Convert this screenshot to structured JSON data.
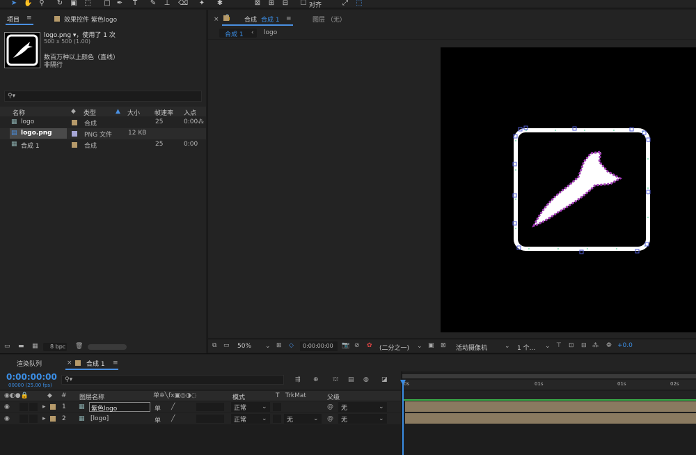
{
  "toolbar": {
    "align_label": "对齐"
  },
  "project": {
    "tab_label": "项目",
    "menu_icon": "hamburger-icon",
    "effects_tab": "效果控件 紫色logo",
    "file_name": "logo.png ▾，使用了 1 次",
    "dimensions": "500 x 500 (1.00)",
    "color_info": "数百万种以上颜色（直线）",
    "interlace": "非隔行",
    "columns": [
      "名称",
      "类型",
      "大小",
      "帧速率",
      "入点"
    ],
    "rows": [
      {
        "name": "logo",
        "type": "合成",
        "size": "",
        "fps": "25",
        "in": "0:00",
        "label_color": "#b69a6a"
      },
      {
        "name": "logo.png",
        "type": "PNG 文件",
        "size": "12 KB",
        "fps": "",
        "in": "",
        "label_color": "#a6a6d6"
      },
      {
        "name": "合成 1",
        "type": "合成",
        "size": "",
        "fps": "25",
        "in": "0:00",
        "label_color": "#b69a6a"
      }
    ],
    "bpc": "8 bpc"
  },
  "composition": {
    "tab_label": "合成",
    "tab_name": "合成 1",
    "layer_tab": "图层 （无）",
    "breadcrumb": [
      "合成 1",
      "logo"
    ],
    "zoom": "50%",
    "timecode": "0:00:00:00",
    "resolution": "(二分之一)",
    "camera": "活动摄像机",
    "views": "1 个...",
    "exposure": "+0.0"
  },
  "timeline": {
    "render_tab": "渲染队列",
    "comp_tab": "合成 1",
    "timecode": "0:00:00:00",
    "frame_info": "00000 (25.00 fps)",
    "headers": {
      "hash": "#",
      "layer_name": "图层名称",
      "mode": "模式",
      "t": "T",
      "trkmat": "TrkMat",
      "parent": "父级"
    },
    "ruler": [
      "0s",
      "01s",
      "01s",
      "02s"
    ],
    "layers": [
      {
        "num": "1",
        "name": "紫色logo",
        "mode": "正常",
        "trkmat": "",
        "parent": "无",
        "switch": "单"
      },
      {
        "num": "2",
        "name": "[logo]",
        "mode": "正常",
        "trkmat": "无",
        "parent": "无",
        "switch": "单"
      }
    ]
  },
  "colors": {
    "accent": "#3b8ee5",
    "panel": "#232323",
    "background": "#1d1d1d"
  }
}
